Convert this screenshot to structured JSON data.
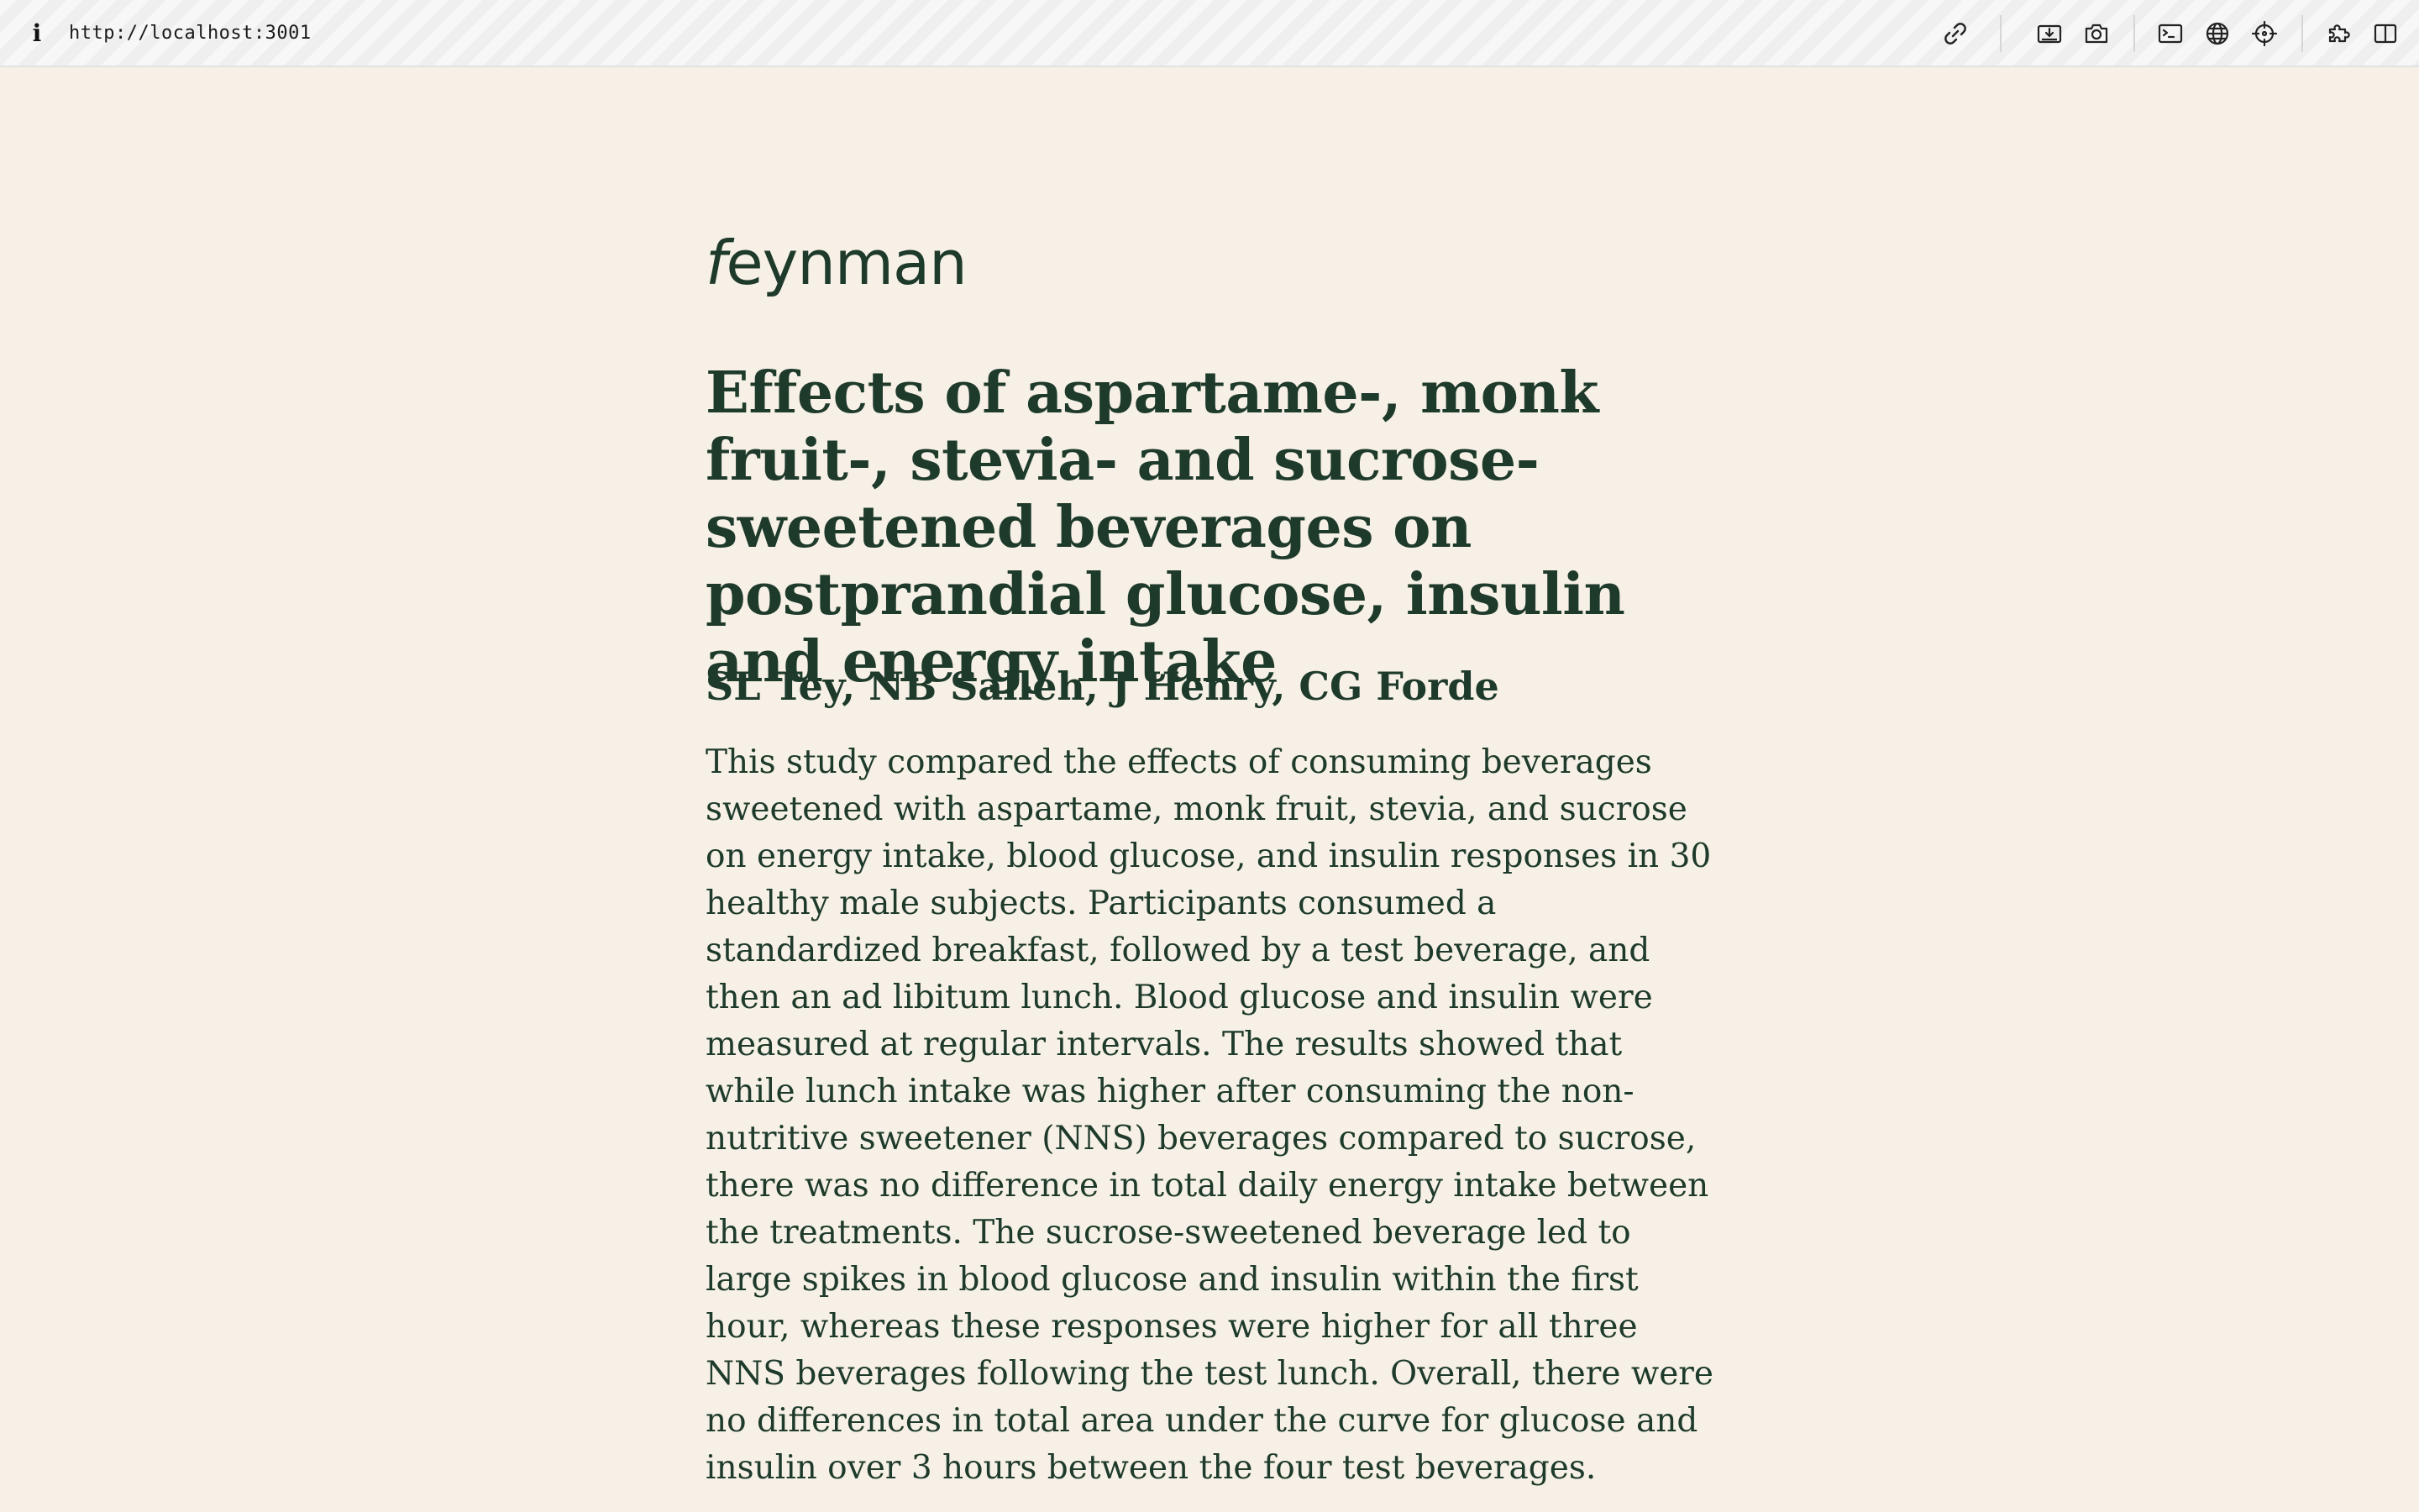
{
  "browser": {
    "info_glyph": "i",
    "url": "http://localhost:3001",
    "tools": [
      {
        "icon": "link-icon"
      },
      {
        "icon": "download-screenshot-icon"
      },
      {
        "icon": "camera-icon"
      },
      {
        "icon": "terminal-icon"
      },
      {
        "icon": "globe-icon"
      },
      {
        "icon": "crosshair-icon"
      },
      {
        "icon": "puzzle-icon"
      },
      {
        "icon": "sidebar-toggle-icon"
      }
    ]
  },
  "site": {
    "logo_first": "f",
    "logo_rest": "eynman"
  },
  "article": {
    "title": "Effects of aspartame-, monk fruit-, stevia- and sucrose-sweetened beverages on postprandial glucose, insulin and energy intake",
    "authors": "SL Tey, NB Salleh, J Henry, CG Forde",
    "abstract": "This study compared the effects of consuming beverages sweetened with aspartame, monk fruit, stevia, and sucrose on energy intake, blood glucose, and insulin responses in 30 healthy male subjects. Participants consumed a standardized breakfast, followed by a test beverage, and then an ad libitum lunch. Blood glucose and insulin were measured at regular intervals. The results showed that while lunch intake was higher after consuming the non-nutritive sweetener (NNS) beverages compared to sucrose, there was no difference in total daily energy intake between the treatments. The sucrose-sweetened beverage led to large spikes in blood glucose and insulin within the first hour, whereas these responses were higher for all three NNS beverages following the test lunch. Overall, there were no differences in total area under the curve for glucose and insulin over 3 hours between the four test beverages."
  },
  "colors": {
    "page_bg": "#f6f0e6",
    "text": "#1e3a2b"
  }
}
